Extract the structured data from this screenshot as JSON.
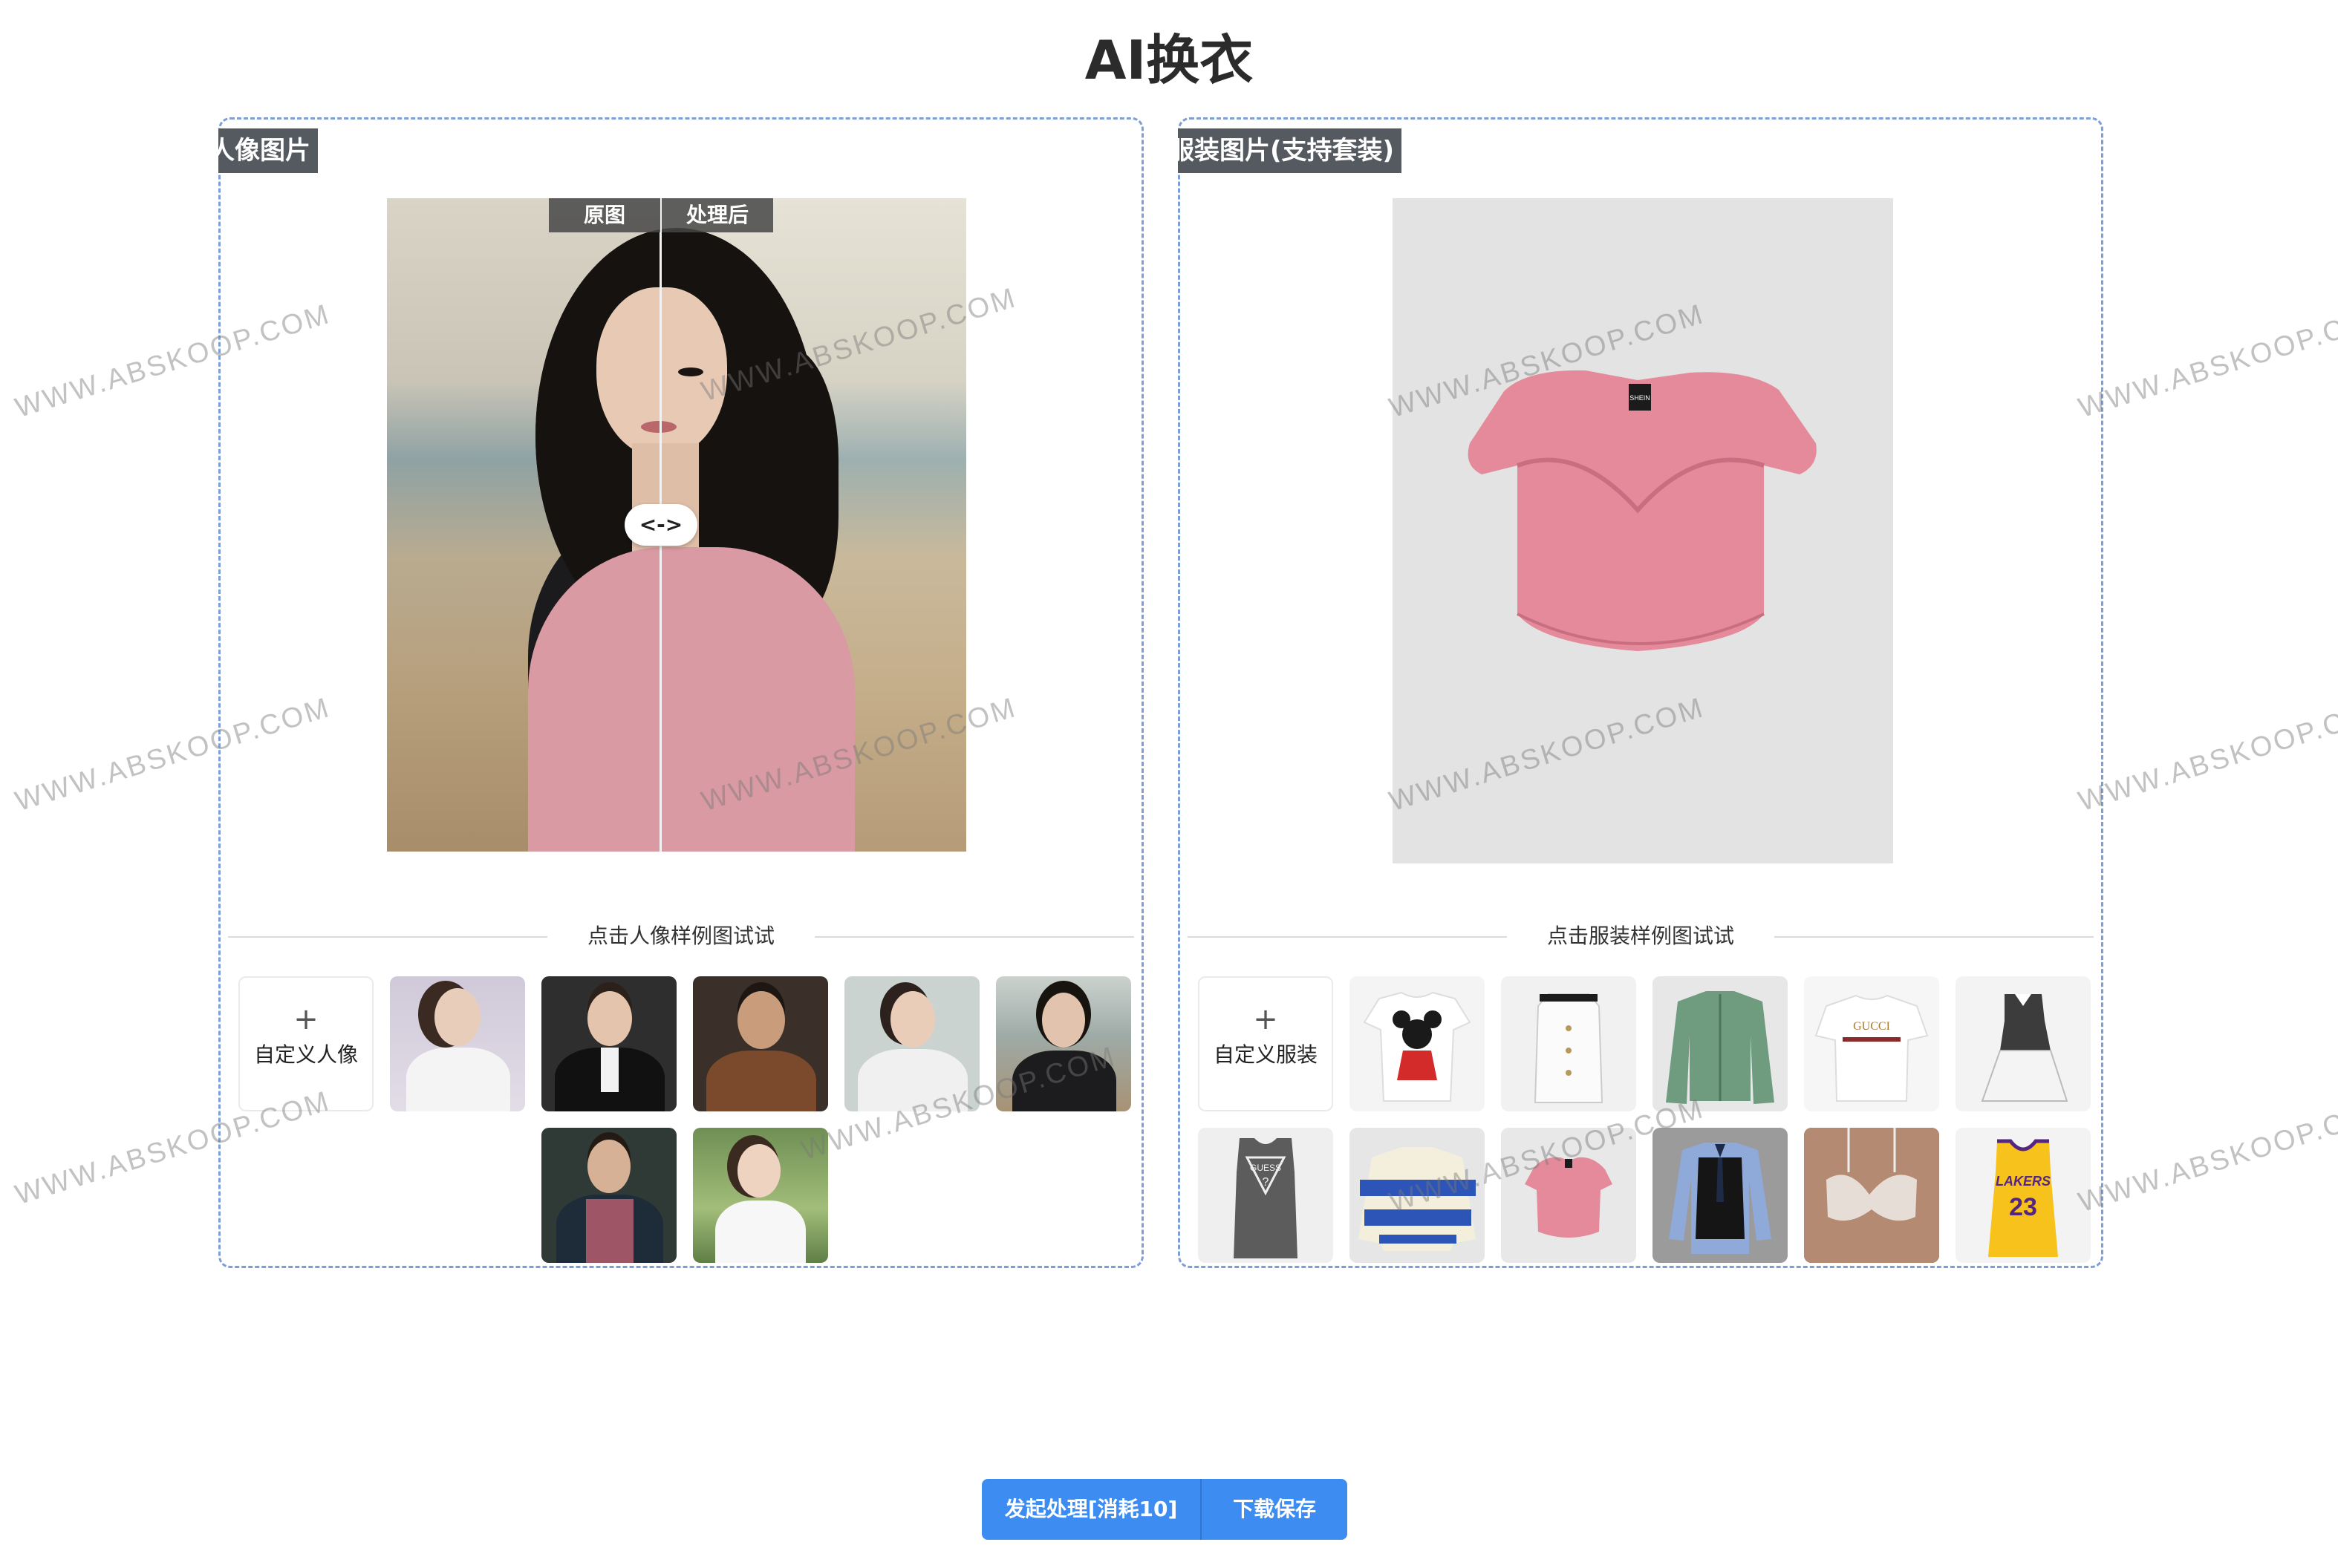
{
  "page": {
    "title": "AI换衣",
    "watermark": "WWW.ABSKOOP.COM"
  },
  "portrait_panel": {
    "tag": "人像图片",
    "label_before": "原图",
    "label_after": "处理后",
    "handle_label": "<->",
    "samples_heading": "点击人像样例图试试",
    "custom_plus": "+",
    "custom_label": "自定义人像",
    "sample_count": 7
  },
  "garment_panel": {
    "tag": "服装图片(支持套装)",
    "samples_heading": "点击服装样例图试试",
    "custom_plus": "+",
    "custom_label": "自定义服装",
    "garment_label_small": "SHEIN",
    "sample_texts": {
      "gucci": "GUCCI",
      "guess": "GUESS",
      "guess_mark": "?",
      "lakers": "LAKERS",
      "lakers_number": "23"
    },
    "sample_count": 11
  },
  "actions": {
    "process_label": "发起处理[消耗10]",
    "save_label": "下载保存"
  },
  "colors": {
    "accent": "#3d8cf1",
    "panel_border": "#7d9fd6",
    "tag_bg": "#555a60",
    "garment_pink": "#e58a9b"
  }
}
